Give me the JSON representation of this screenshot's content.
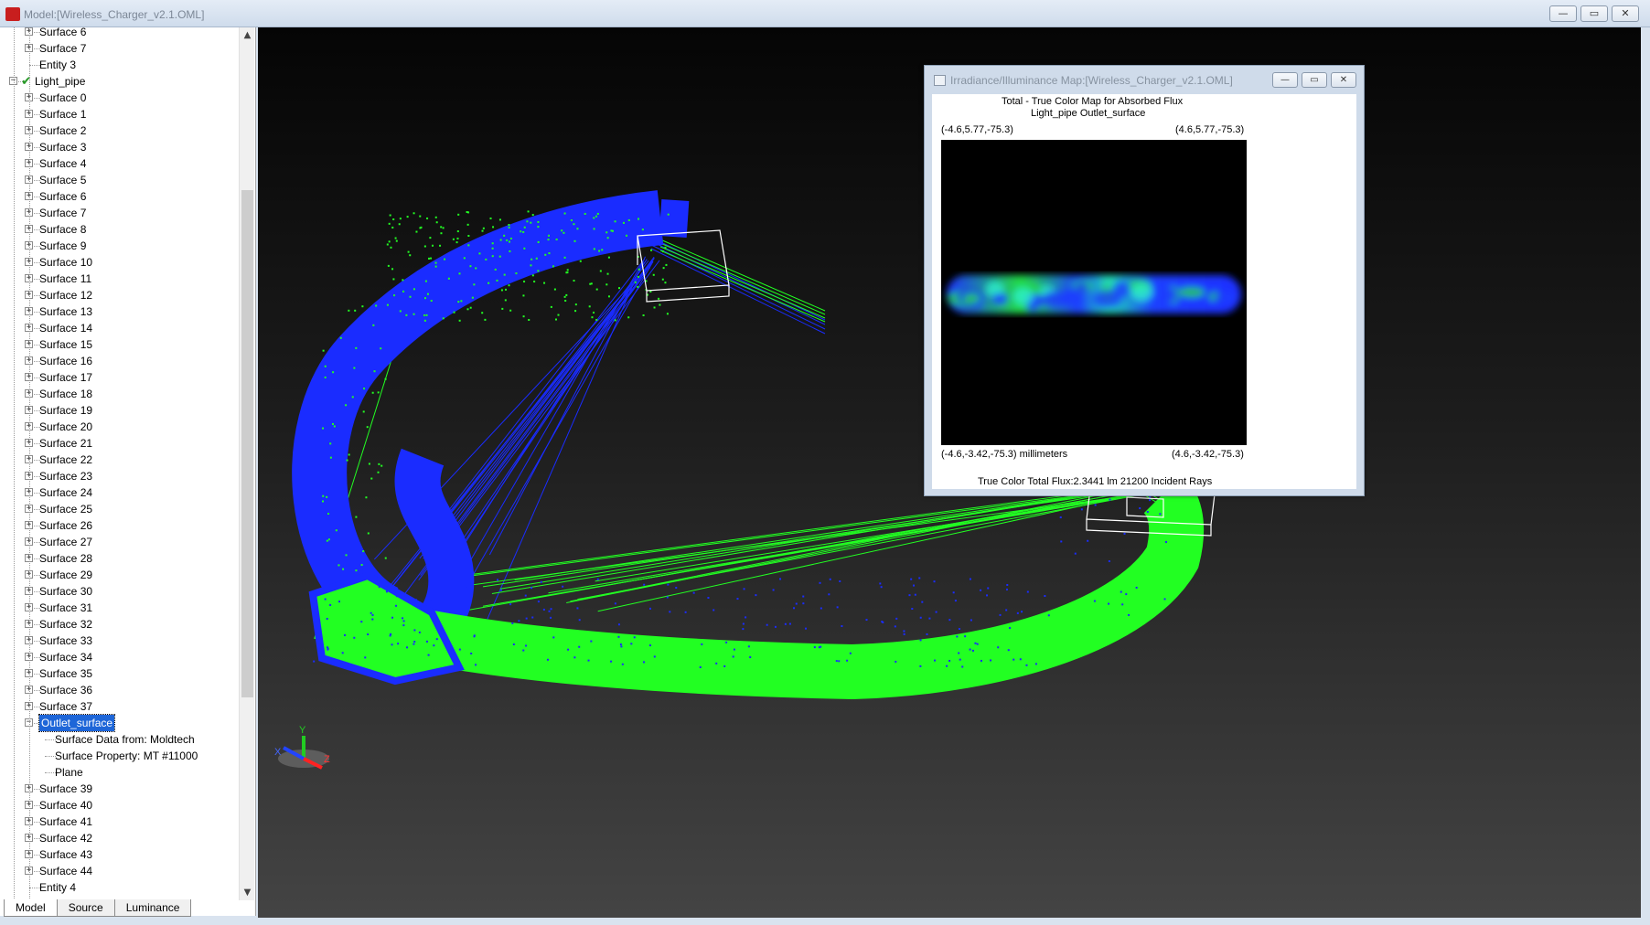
{
  "window": {
    "title": "Model:[Wireless_Charger_v2.1.OML]",
    "controls": [
      "—",
      "▭",
      "✕"
    ]
  },
  "tree": {
    "items": [
      {
        "label": "Surface 6",
        "level": 1,
        "expander": "+"
      },
      {
        "label": "Surface 7",
        "level": 1,
        "expander": "+"
      },
      {
        "label": "Entity 3",
        "level": 1,
        "expander": ""
      },
      {
        "label": "Light_pipe",
        "level": 0,
        "expander": "−",
        "checked": true
      },
      {
        "label": "Surface 0",
        "level": 1,
        "expander": "+"
      },
      {
        "label": "Surface 1",
        "level": 1,
        "expander": "+"
      },
      {
        "label": "Surface 2",
        "level": 1,
        "expander": "+"
      },
      {
        "label": "Surface 3",
        "level": 1,
        "expander": "+"
      },
      {
        "label": "Surface 4",
        "level": 1,
        "expander": "+"
      },
      {
        "label": "Surface 5",
        "level": 1,
        "expander": "+"
      },
      {
        "label": "Surface 6",
        "level": 1,
        "expander": "+"
      },
      {
        "label": "Surface 7",
        "level": 1,
        "expander": "+"
      },
      {
        "label": "Surface 8",
        "level": 1,
        "expander": "+"
      },
      {
        "label": "Surface 9",
        "level": 1,
        "expander": "+"
      },
      {
        "label": "Surface 10",
        "level": 1,
        "expander": "+"
      },
      {
        "label": "Surface 11",
        "level": 1,
        "expander": "+"
      },
      {
        "label": "Surface 12",
        "level": 1,
        "expander": "+"
      },
      {
        "label": "Surface 13",
        "level": 1,
        "expander": "+"
      },
      {
        "label": "Surface 14",
        "level": 1,
        "expander": "+"
      },
      {
        "label": "Surface 15",
        "level": 1,
        "expander": "+"
      },
      {
        "label": "Surface 16",
        "level": 1,
        "expander": "+"
      },
      {
        "label": "Surface 17",
        "level": 1,
        "expander": "+"
      },
      {
        "label": "Surface 18",
        "level": 1,
        "expander": "+"
      },
      {
        "label": "Surface 19",
        "level": 1,
        "expander": "+"
      },
      {
        "label": "Surface 20",
        "level": 1,
        "expander": "+"
      },
      {
        "label": "Surface 21",
        "level": 1,
        "expander": "+"
      },
      {
        "label": "Surface 22",
        "level": 1,
        "expander": "+"
      },
      {
        "label": "Surface 23",
        "level": 1,
        "expander": "+"
      },
      {
        "label": "Surface 24",
        "level": 1,
        "expander": "+"
      },
      {
        "label": "Surface 25",
        "level": 1,
        "expander": "+"
      },
      {
        "label": "Surface 26",
        "level": 1,
        "expander": "+"
      },
      {
        "label": "Surface 27",
        "level": 1,
        "expander": "+"
      },
      {
        "label": "Surface 28",
        "level": 1,
        "expander": "+"
      },
      {
        "label": "Surface 29",
        "level": 1,
        "expander": "+"
      },
      {
        "label": "Surface 30",
        "level": 1,
        "expander": "+"
      },
      {
        "label": "Surface 31",
        "level": 1,
        "expander": "+"
      },
      {
        "label": "Surface 32",
        "level": 1,
        "expander": "+"
      },
      {
        "label": "Surface 33",
        "level": 1,
        "expander": "+"
      },
      {
        "label": "Surface 34",
        "level": 1,
        "expander": "+"
      },
      {
        "label": "Surface 35",
        "level": 1,
        "expander": "+"
      },
      {
        "label": "Surface 36",
        "level": 1,
        "expander": "+"
      },
      {
        "label": "Surface 37",
        "level": 1,
        "expander": "+"
      },
      {
        "label": "Outlet_surface",
        "level": 1,
        "expander": "−",
        "selected": true
      },
      {
        "label": "Surface Data from: Moldtech",
        "level": 2,
        "expander": ""
      },
      {
        "label": "Surface Property: MT #11000",
        "level": 2,
        "expander": ""
      },
      {
        "label": "Plane",
        "level": 2,
        "expander": ""
      },
      {
        "label": "Surface 39",
        "level": 1,
        "expander": "+"
      },
      {
        "label": "Surface 40",
        "level": 1,
        "expander": "+"
      },
      {
        "label": "Surface 41",
        "level": 1,
        "expander": "+"
      },
      {
        "label": "Surface 42",
        "level": 1,
        "expander": "+"
      },
      {
        "label": "Surface 43",
        "level": 1,
        "expander": "+"
      },
      {
        "label": "Surface 44",
        "level": 1,
        "expander": "+"
      },
      {
        "label": "Entity 4",
        "level": 1,
        "expander": ""
      }
    ]
  },
  "scroll": {
    "up": "▲",
    "down": "▼"
  },
  "tabs": [
    {
      "label": "Model",
      "active": true
    },
    {
      "label": "Source",
      "active": false
    },
    {
      "label": "Luminance",
      "active": false
    }
  ],
  "axes": {
    "x": "X",
    "y": "Y",
    "z": "Z"
  },
  "map_window": {
    "title": "Irradiance/Illuminance Map:[Wireless_Charger_v2.1.OML]",
    "controls": [
      "—",
      "▭",
      "✕"
    ],
    "heading1": "Total - True Color Map for Absorbed Flux",
    "heading2": "Light_pipe Outlet_surface",
    "corner_top_left": "(-4.6,5.77,-75.3)",
    "corner_top_right": "(4.6,5.77,-75.3)",
    "corner_bottom_left": "(-4.6,-3.42,-75.3) millimeters",
    "corner_bottom_right": "(4.6,-3.42,-75.3)",
    "footer": "True Color Total Flux:2.3441 lm 21200 Incident Rays"
  },
  "colors": {
    "ray_blue": "#1a2cff",
    "ray_green": "#22ff22",
    "selection": "#1e66d8"
  }
}
